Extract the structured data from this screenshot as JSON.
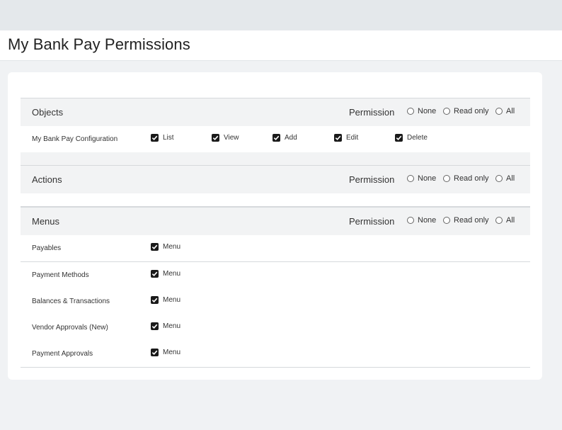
{
  "page": {
    "title": "My Bank Pay Permissions"
  },
  "radio_options": {
    "none": "None",
    "read_only": "Read only",
    "all": "All"
  },
  "permission_label": "Permission",
  "sections": {
    "objects": {
      "title": "Objects",
      "rows": [
        {
          "label": "My Bank Pay Configuration",
          "checks": [
            "List",
            "View",
            "Add",
            "Edit",
            "Delete"
          ],
          "checked": [
            true,
            true,
            true,
            true,
            true
          ]
        }
      ]
    },
    "actions": {
      "title": "Actions"
    },
    "menus": {
      "title": "Menus",
      "rows": [
        {
          "label": "Payables",
          "check": "Menu",
          "checked": true
        },
        {
          "label": "Payment Methods",
          "check": "Menu",
          "checked": true
        },
        {
          "label": "Balances & Transactions",
          "check": "Menu",
          "checked": true
        },
        {
          "label": "Vendor Approvals (New)",
          "check": "Menu",
          "checked": true
        },
        {
          "label": "Payment Approvals",
          "check": "Menu",
          "checked": true
        }
      ]
    }
  },
  "colors": {
    "top_bar": "#e4e8eb",
    "background": "#f0f2f4",
    "header_band": "#f2f3f4",
    "checkbox_fill": "#1a1a1a"
  },
  "icons": {
    "checkbox": "checkmark-icon",
    "radio": "radio-circle-icon"
  }
}
